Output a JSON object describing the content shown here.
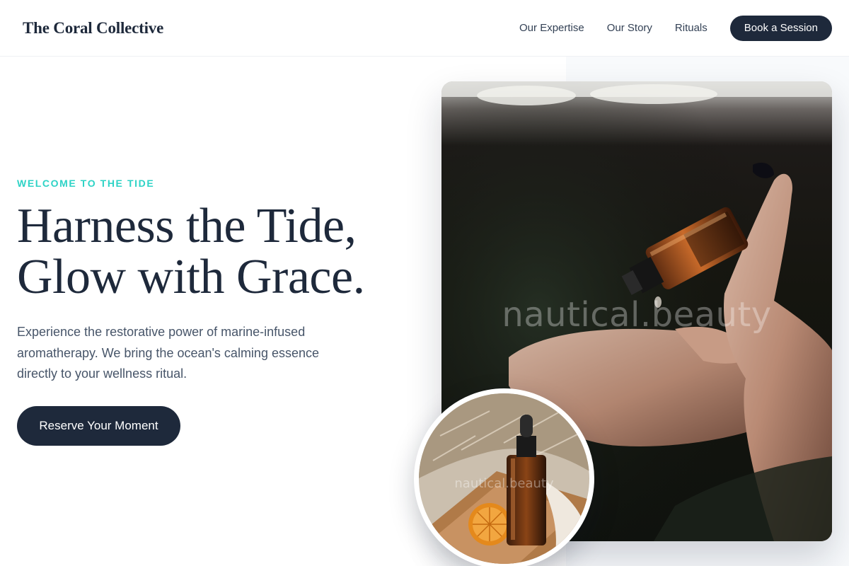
{
  "brand": {
    "name": "The Coral Collective"
  },
  "nav": {
    "links": [
      "Our Expertise",
      "Our Story",
      "Rituals"
    ],
    "cta_label": "Book a Session"
  },
  "hero": {
    "eyebrow": "WELCOME TO THE TIDE",
    "headline_line1": "Harness the Tide,",
    "headline_line2": "Glow with Grace.",
    "description": "Experience the restorative power of marine-infused aromatherapy. We bring the ocean's calming essence directly to your wellness ritual.",
    "cta_label": "Reserve Your Moment"
  },
  "images": {
    "main_watermark": "nautical.beauty",
    "small_watermark": "nautical.beauty"
  },
  "colors": {
    "primary": "#1e293b",
    "accent": "#2ed3c6",
    "body_text": "#475569",
    "muted_bg": "#f8fafc"
  }
}
